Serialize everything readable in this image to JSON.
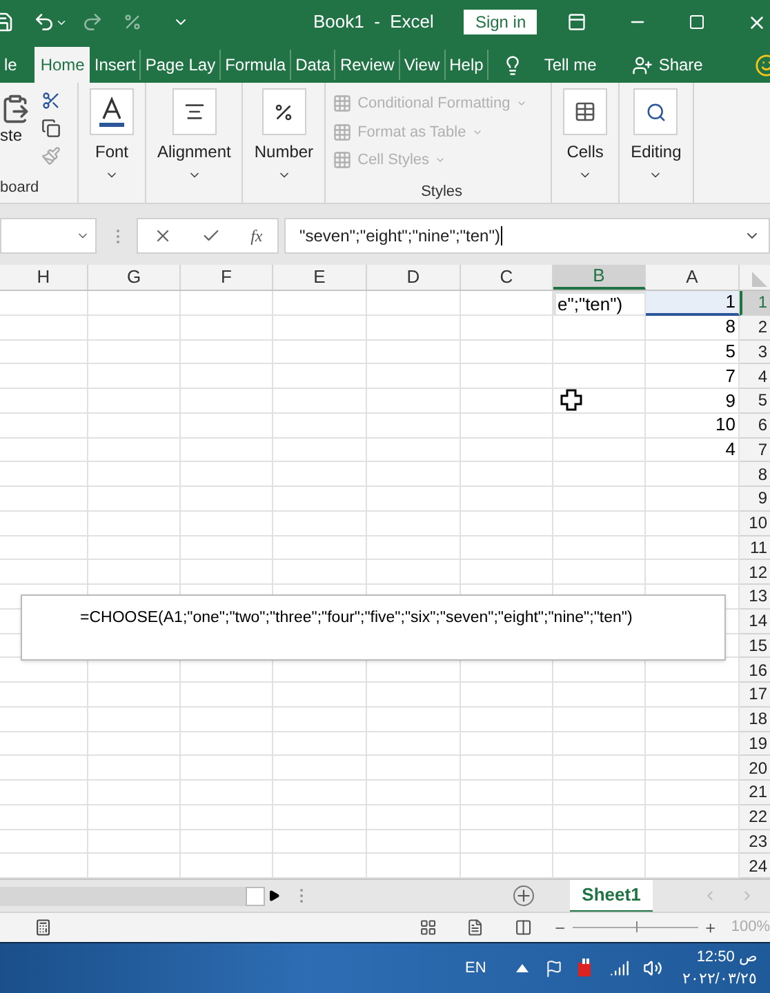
{
  "title_bar": {
    "title": "Book1  -  Excel",
    "sign_in": "Sign in"
  },
  "tabs": [
    {
      "label": "le",
      "selected": false
    },
    {
      "label": "Home",
      "selected": true
    },
    {
      "label": "Insert",
      "selected": false
    },
    {
      "label": "Page Lay",
      "selected": false
    },
    {
      "label": "Formula",
      "selected": false
    },
    {
      "label": "Data",
      "selected": false
    },
    {
      "label": "Review",
      "selected": false
    },
    {
      "label": "View",
      "selected": false
    },
    {
      "label": "Help",
      "selected": false
    }
  ],
  "tell_me": "Tell me",
  "share": "Share",
  "ribbon": {
    "clipboard": {
      "paste": "ste",
      "label": "board"
    },
    "buttons": [
      {
        "label": "Font",
        "kind": "font"
      },
      {
        "label": "Alignment",
        "kind": "alignment"
      },
      {
        "label": "Number",
        "kind": "number"
      }
    ],
    "styles": {
      "items": [
        {
          "label": "Conditional Formatting",
          "disabled": true
        },
        {
          "label": "Format as Table",
          "disabled": true
        },
        {
          "label": "Cell Styles",
          "disabled": true
        }
      ],
      "label": "Styles"
    },
    "right_buttons": [
      {
        "label": "Cells",
        "kind": "cells"
      },
      {
        "label": "Editing",
        "kind": "editing"
      }
    ]
  },
  "formula_bar": {
    "fx": "fx",
    "value": "\"seven\";\"eight\";\"nine\";\"ten\")"
  },
  "columns": [
    {
      "label": "H",
      "selected": false
    },
    {
      "label": "G",
      "selected": false
    },
    {
      "label": "F",
      "selected": false
    },
    {
      "label": "E",
      "selected": false
    },
    {
      "label": "D",
      "selected": false
    },
    {
      "label": "C",
      "selected": false
    },
    {
      "label": "B",
      "selected": true
    },
    {
      "label": "A",
      "selected": false
    }
  ],
  "rows": [
    {
      "number": "1",
      "selected": true,
      "column_a": "1",
      "column_b": "e\";\"ten\")"
    },
    {
      "number": "2",
      "selected": false,
      "column_a": "8"
    },
    {
      "number": "3",
      "selected": false,
      "column_a": "5"
    },
    {
      "number": "4",
      "selected": false,
      "column_a": "7"
    },
    {
      "number": "5",
      "selected": false,
      "column_a": "9"
    },
    {
      "number": "6",
      "selected": false,
      "column_a": "10"
    },
    {
      "number": "7",
      "selected": false,
      "column_a": "4"
    },
    {
      "number": "8",
      "selected": false
    },
    {
      "number": "9",
      "selected": false
    },
    {
      "number": "10",
      "selected": false
    },
    {
      "number": "11",
      "selected": false
    },
    {
      "number": "12",
      "selected": false
    },
    {
      "number": "13",
      "selected": false
    },
    {
      "number": "14",
      "selected": false
    },
    {
      "number": "15",
      "selected": false
    },
    {
      "number": "16",
      "selected": false
    },
    {
      "number": "17",
      "selected": false
    },
    {
      "number": "18",
      "selected": false
    },
    {
      "number": "19",
      "selected": false
    },
    {
      "number": "20",
      "selected": false
    },
    {
      "number": "21",
      "selected": false
    },
    {
      "number": "22",
      "selected": false
    },
    {
      "number": "23",
      "selected": false
    },
    {
      "number": "24",
      "selected": false
    }
  ],
  "formula_popup": "=CHOOSE(A1;\"one\";\"two\";\"three\";\"four\";\"five\";\"six\";\"seven\";\"eight\";\"nine\";\"ten\")",
  "sheet_tabs": [
    {
      "label": "Sheet1",
      "selected": true
    }
  ],
  "status_bar": {
    "zoom": "100%",
    "zoom_slider": {
      "level": 0.5
    }
  },
  "taskbar": {
    "language": "EN",
    "time": "ص 12:50",
    "date": "٢٠٢٢/٠٣/٢٥"
  }
}
